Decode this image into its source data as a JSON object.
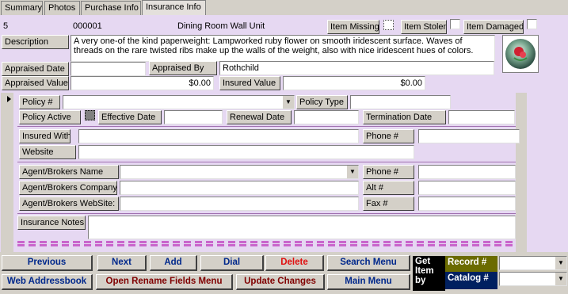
{
  "tabs": [
    "Summary",
    "Photos",
    "Purchase Info",
    "Insurance Info"
  ],
  "item": {
    "number": "5",
    "code": "000001",
    "name": "Dining Room Wall Unit",
    "missing_label": "Item Missing",
    "stolen_label": "Item Stolen",
    "damaged_label": "Item Damaged",
    "description_label": "Description",
    "description": "A very one-of the kind paperweight: Lampworked ruby flower on smooth iridescent surface.  Waves of threads on the rare twisted ribs make up the walls of the weight, also with nice iridescent hues of colors.",
    "appraised_date_label": "Appraised Date",
    "appraised_date": "",
    "appraised_by_label": "Appraised By",
    "appraised_by": "Rothchild",
    "appraised_value_label": "Appraised Value",
    "appraised_value": "$0.00",
    "insured_value_label": "Insured Value",
    "insured_value": "$0.00"
  },
  "policy": {
    "policy_no_label": "Policy #",
    "policy_no": "",
    "policy_type_label": "Policy Type",
    "policy_type": "",
    "active_label": "Policy Active",
    "effective_label": "Effective Date",
    "effective": "",
    "renewal_label": "Renewal Date",
    "renewal": "",
    "termination_label": "Termination Date",
    "termination": "",
    "insured_with_label": "Insured With",
    "insured_with": "",
    "phone_label": "Phone #",
    "phone": "",
    "website_label": "Website",
    "website": "",
    "agent_name_label": "Agent/Brokers Name",
    "agent_name": "",
    "agent_phone_label": "Phone #",
    "agent_phone": "",
    "agent_company_label": "Agent/Brokers Company",
    "agent_company": "",
    "alt_label": "Alt #",
    "alt": "",
    "agent_website_label": "Agent/Brokers WebSite:",
    "agent_website": "",
    "fax_label": "Fax #",
    "fax": "",
    "notes_label": "Insurance Notes",
    "notes": ""
  },
  "nav": {
    "previous": "Previous",
    "next": "Next",
    "add": "Add",
    "dial": "Dial",
    "delete": "Delete",
    "search_menu": "Search Menu",
    "web_addressbook": "Web Addressbook",
    "rename_fields": "Open Rename Fields Menu",
    "update_changes": "Update Changes",
    "main_menu": "Main Menu",
    "get_item_by": "Get Item by",
    "record_label": "Record #",
    "catalog_label": "Catalog #"
  },
  "colors": {
    "panel": "#e6d8f2",
    "accent_navy": "#00288c",
    "accent_maroon": "#800000",
    "delete_red": "#e01010",
    "record_bg": "#6b6b00",
    "catalog_bg": "#002060"
  }
}
